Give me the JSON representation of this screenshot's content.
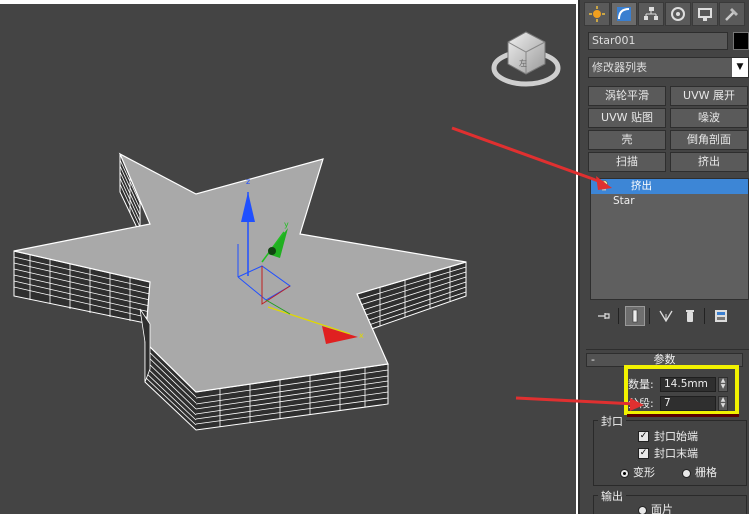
{
  "panel": {
    "tabs": [
      {
        "icon": "create-icon"
      },
      {
        "icon": "modify-icon"
      },
      {
        "icon": "hierarchy-icon"
      },
      {
        "icon": "motion-icon"
      },
      {
        "icon": "display-icon"
      },
      {
        "icon": "utilities-icon"
      }
    ],
    "object_name": "Star001",
    "modifier_list": "修改器列表",
    "modifier_buttons": [
      "涡轮平滑",
      "UVW 展开",
      "UVW 贴图",
      "噪波",
      "壳",
      "倒角剖面",
      "扫描",
      "挤出"
    ],
    "stack": {
      "selected": "挤出",
      "base": "Star"
    },
    "rollout": {
      "title": "参数",
      "amount_label": "数量:",
      "amount_value": "14.5mm",
      "segments_label": "分段:",
      "segments_value": "7",
      "capping": {
        "title": "封口",
        "cap_start": "封口始端",
        "cap_end": "封口末端",
        "morph": "变形",
        "grid": "栅格"
      },
      "output": {
        "title": "输出",
        "patch": "面片"
      }
    }
  },
  "viewport": {
    "gizmo_labels": {
      "x": "x",
      "y": "y",
      "z": "z"
    }
  },
  "colors": {
    "viewport_bg": "#444444",
    "selection": "#3d86d6",
    "highlight_yellow": "#f2f200",
    "arrow_red": "#e03030"
  }
}
